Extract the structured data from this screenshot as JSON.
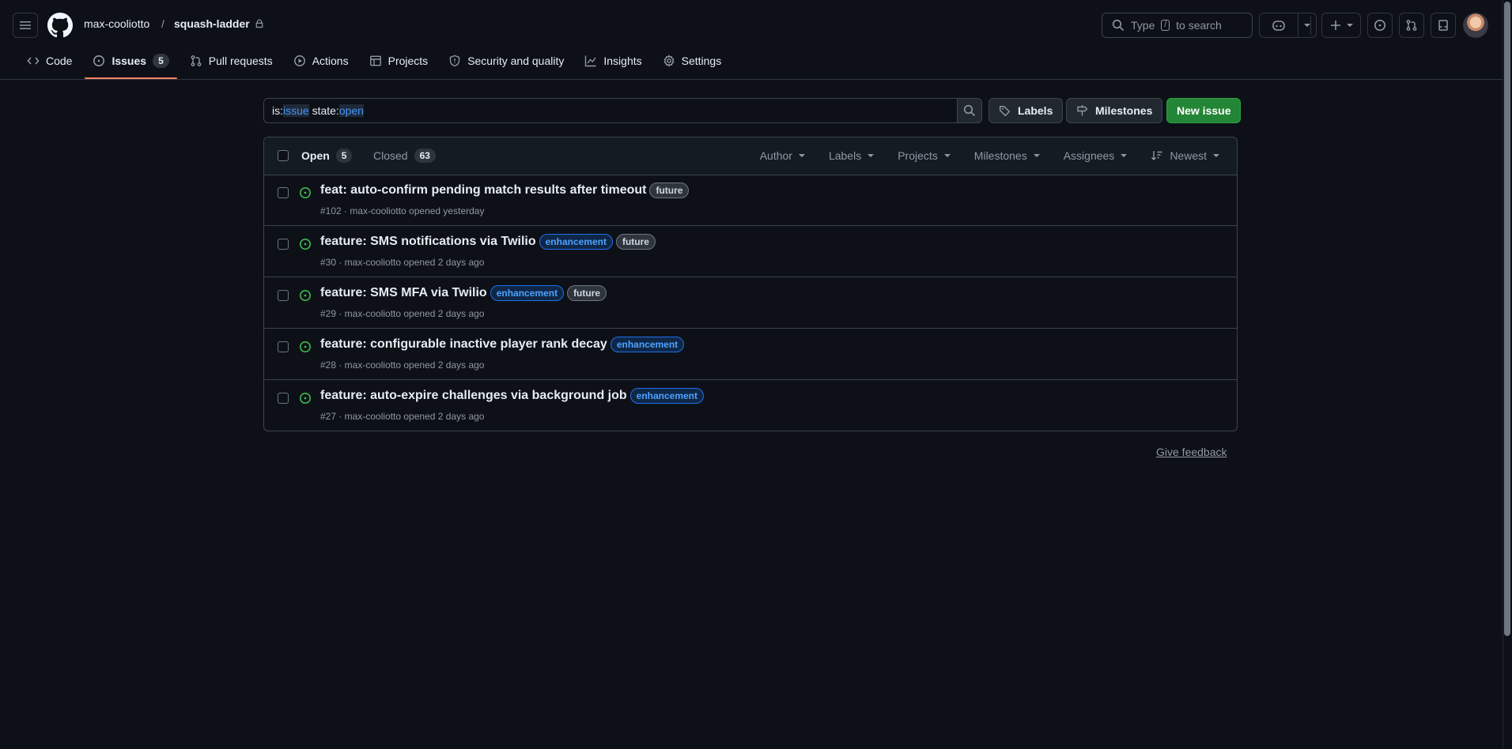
{
  "header": {
    "owner": "max-cooliotto",
    "separator": "/",
    "repo": "squash-ladder",
    "search_prefix": "Type",
    "search_key": "/",
    "search_suffix": "to search"
  },
  "tabs": [
    {
      "label": "Code",
      "icon": "code-icon"
    },
    {
      "label": "Issues",
      "icon": "issue-opened-icon",
      "count": "5",
      "selected": true
    },
    {
      "label": "Pull requests",
      "icon": "git-pull-request-icon"
    },
    {
      "label": "Actions",
      "icon": "play-icon"
    },
    {
      "label": "Projects",
      "icon": "table-icon"
    },
    {
      "label": "Security and quality",
      "icon": "shield-icon"
    },
    {
      "label": "Insights",
      "icon": "graph-icon"
    },
    {
      "label": "Settings",
      "icon": "gear-icon"
    }
  ],
  "filter": {
    "k1": "is:",
    "v1": "issue",
    "k2": "state:",
    "v2": "open"
  },
  "buttons": {
    "labels": "Labels",
    "milestones": "Milestones",
    "new_issue": "New issue"
  },
  "list": {
    "open_label": "Open",
    "open_count": "5",
    "closed_label": "Closed",
    "closed_count": "63",
    "filters": [
      "Author",
      "Labels",
      "Projects",
      "Milestones",
      "Assignees"
    ],
    "sort": "Newest"
  },
  "issues": [
    {
      "title": "feat: auto-confirm pending match results after timeout",
      "labels": [
        "future"
      ],
      "meta": "#102 · max-cooliotto opened yesterday"
    },
    {
      "title": "feature: SMS notifications via Twilio",
      "labels": [
        "enhancement",
        "future"
      ],
      "meta": "#30 · max-cooliotto opened 2 days ago"
    },
    {
      "title": "feature: SMS MFA via Twilio",
      "labels": [
        "enhancement",
        "future"
      ],
      "meta": "#29 · max-cooliotto opened 2 days ago"
    },
    {
      "title": "feature: configurable inactive player rank decay",
      "labels": [
        "enhancement"
      ],
      "meta": "#28 · max-cooliotto opened 2 days ago"
    },
    {
      "title": "feature: auto-expire challenges via background job",
      "labels": [
        "enhancement"
      ],
      "meta": "#27 · max-cooliotto opened 2 days ago"
    }
  ],
  "feedback": "Give feedback",
  "colors": {
    "background": "#0d1117",
    "accent_tab": "#f78166",
    "open_green": "#3fb950",
    "primary_button": "#238636",
    "enhancement": "#4da3ff"
  }
}
